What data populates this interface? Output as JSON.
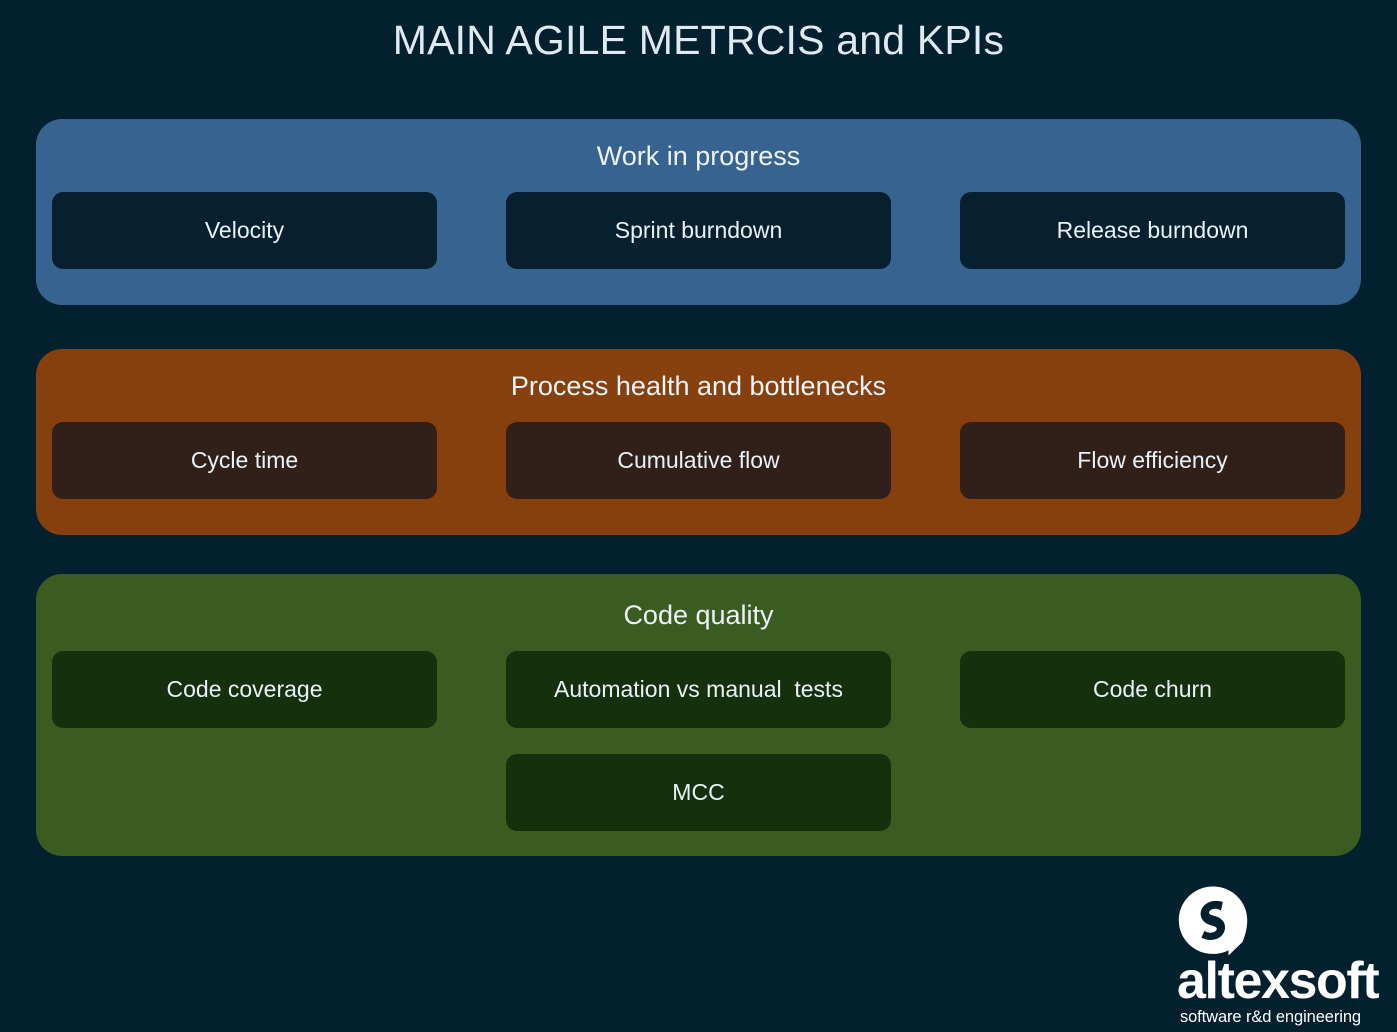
{
  "page": {
    "title": "MAIN AGILE METRCIS and KPIs",
    "background_color": "#03202f"
  },
  "sections": [
    {
      "key": "work_in_progress",
      "title": "Work in progress",
      "band_color": "#376391",
      "card_color": "#07202f",
      "cards": [
        {
          "label": "Velocity"
        },
        {
          "label": "Sprint burndown"
        },
        {
          "label": "Release burndown"
        }
      ]
    },
    {
      "key": "process_health",
      "title": "Process health and bottlenecks",
      "band_color": "#85400e",
      "card_color": "#31201a",
      "cards": [
        {
          "label": "Cycle time"
        },
        {
          "label": "Cumulative flow"
        },
        {
          "label": "Flow efficiency"
        }
      ]
    },
    {
      "key": "code_quality",
      "title": "Code quality",
      "band_color": "#3b5c20",
      "card_color": "#14300c",
      "cards": [
        {
          "label": "Code coverage"
        },
        {
          "label": "Automation vs manual  tests"
        },
        {
          "label": "Code churn"
        }
      ],
      "cards_second_row": [
        {
          "label": "MCC"
        }
      ]
    }
  ],
  "logo": {
    "wordmark": "altexsoft",
    "tagline": "software r&d engineering",
    "mark_color": "#ffffff",
    "mark_icon": "altexsoft-speech-bubble-a-icon"
  }
}
